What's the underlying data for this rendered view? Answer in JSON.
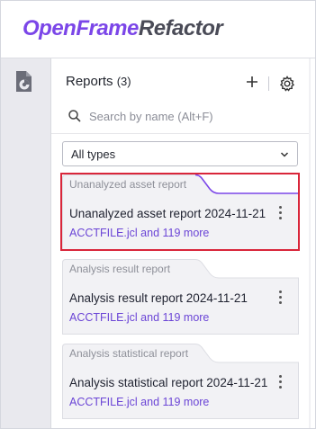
{
  "app": {
    "brand_part1": "OpenFrame",
    "brand_part2": "Refactor",
    "accent_color": "#7b46e8"
  },
  "rail": {
    "icons": [
      "report-document-icon"
    ]
  },
  "reports_panel": {
    "title": "Reports",
    "count": "(3)",
    "add_icon": "plus-icon",
    "settings_icon": "gear-icon",
    "search": {
      "placeholder": "Search by name (Alt+F)",
      "value": ""
    },
    "type_filter": {
      "selected": "All types"
    },
    "cards": [
      {
        "tag": "Unanalyzed asset report",
        "name": "Unanalyzed asset report 2024-11-21",
        "files": "ACCTFILE.jcl and 119 more",
        "selected": true
      },
      {
        "tag": "Analysis result report",
        "name": "Analysis result report 2024-11-21",
        "files": "ACCTFILE.jcl and 119 more",
        "selected": false
      },
      {
        "tag": "Analysis statistical report",
        "name": "Analysis statistical report 2024-11-21",
        "files": "ACCTFILE.jcl and 119 more",
        "selected": false
      }
    ]
  }
}
